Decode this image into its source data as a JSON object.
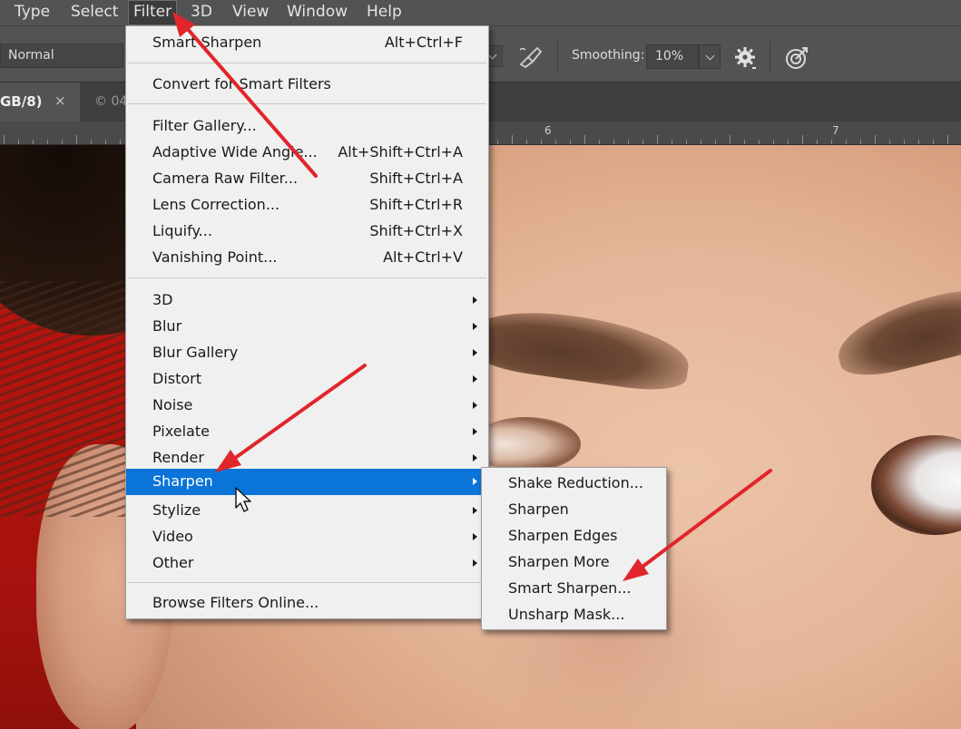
{
  "menubar": {
    "items": [
      {
        "label": "Type"
      },
      {
        "label": "Select"
      },
      {
        "label": "Filter",
        "active": true
      },
      {
        "label": "3D"
      },
      {
        "label": "View"
      },
      {
        "label": "Window"
      },
      {
        "label": "Help"
      }
    ]
  },
  "options_bar": {
    "mode": "Normal",
    "smoothing_label": "Smoothing:",
    "smoothing_value": "10%",
    "icons": [
      "airbrush-icon",
      "gear-icon",
      "symmetry-icon"
    ]
  },
  "tabs": {
    "active_label": "GB/8)",
    "close_glyph": "×",
    "second_label": "© 04"
  },
  "ruler": {
    "labels": [
      "6",
      "7"
    ]
  },
  "filter_menu": {
    "items": [
      {
        "label": "Smart Sharpen",
        "shortcut": "Alt+Ctrl+F"
      },
      {
        "label": "Convert for Smart Filters"
      },
      {
        "label": "Filter Gallery..."
      },
      {
        "label": "Adaptive Wide Angle...",
        "shortcut": "Alt+Shift+Ctrl+A"
      },
      {
        "label": "Camera Raw Filter...",
        "shortcut": "Shift+Ctrl+A"
      },
      {
        "label": "Lens Correction...",
        "shortcut": "Shift+Ctrl+R"
      },
      {
        "label": "Liquify...",
        "shortcut": "Shift+Ctrl+X"
      },
      {
        "label": "Vanishing Point...",
        "shortcut": "Alt+Ctrl+V"
      },
      {
        "label": "3D",
        "submenu": true
      },
      {
        "label": "Blur",
        "submenu": true
      },
      {
        "label": "Blur Gallery",
        "submenu": true
      },
      {
        "label": "Distort",
        "submenu": true
      },
      {
        "label": "Noise",
        "submenu": true
      },
      {
        "label": "Pixelate",
        "submenu": true
      },
      {
        "label": "Render",
        "submenu": true
      },
      {
        "label": "Sharpen",
        "submenu": true,
        "highlighted": true
      },
      {
        "label": "Stylize",
        "submenu": true
      },
      {
        "label": "Video",
        "submenu": true
      },
      {
        "label": "Other",
        "submenu": true
      },
      {
        "label": "Browse Filters Online..."
      }
    ]
  },
  "sharpen_submenu": {
    "items": [
      {
        "label": "Shake Reduction..."
      },
      {
        "label": "Sharpen"
      },
      {
        "label": "Sharpen Edges"
      },
      {
        "label": "Sharpen More"
      },
      {
        "label": "Smart Sharpen..."
      },
      {
        "label": "Unsharp Mask..."
      }
    ]
  },
  "colors": {
    "menu_highlight": "#0a74d8",
    "annotation_arrow": "#e0262c",
    "ui_panel": "#535353"
  }
}
